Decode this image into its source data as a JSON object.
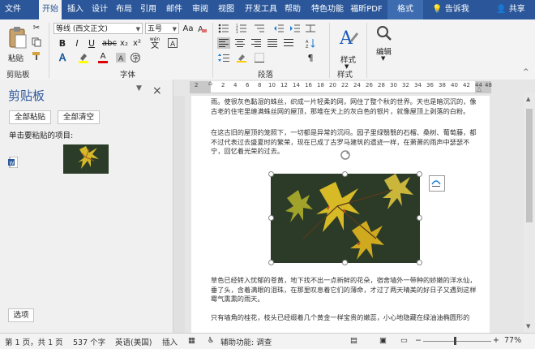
{
  "tabs": [
    "文件",
    "开始",
    "插入",
    "设计",
    "布局",
    "引用",
    "邮件",
    "审阅",
    "视图",
    "开发工具",
    "帮助",
    "特色功能",
    "福昕PDF",
    "格式"
  ],
  "tell_me": "告诉我",
  "share": "共享",
  "ribbon": {
    "paste_label": "粘贴",
    "clipboard_group": "剪贴板",
    "font_name": "等线 (西文正文)",
    "font_size": "五号",
    "font_group": "字体",
    "paragraph_group": "段落",
    "styles_group": "样式",
    "styles_label": "样式",
    "editing_label": "编辑",
    "bold": "B",
    "italic": "I",
    "underline": "U",
    "wen": "wén",
    "font_a": "A",
    "aa": "Aa",
    "highlight_color": "#ffff00",
    "font_color": "#e00000"
  },
  "clipboard_pane": {
    "title": "剪贴板",
    "paste_all": "全部粘贴",
    "clear_all": "全部清空",
    "hint": "单击要粘贴的项目:",
    "options": "选项"
  },
  "ruler_ticks": [
    "2",
    "2",
    "4",
    "6",
    "8",
    "10",
    "12",
    "14",
    "16",
    "18",
    "20",
    "22",
    "24",
    "26",
    "28",
    "30",
    "32",
    "34",
    "36",
    "38",
    "40",
    "42",
    "44",
    "48"
  ],
  "document": {
    "p1": "雨。使很灰色黏湿的蛛丝，织成一片轻柔的网，网住了整个秋的世界。天也是暗沉沉的，像古老的住宅里缠满蛛丝网的屋顶，那堆在天上的灰白色的银片，就像屋顶上剥落的白粉。",
    "p2": "在这古旧的屋顶的笼照下，一切都是异常的沉闷。园子里绿翳翳的石榴、桑树、葡萄藤，都不过代表过去盛夏时的繁荣，现在已成了古罗马建筑的遗迹一样，在萧萧的雨声中瑟瑟不宁，回忆着光荣的过去。",
    "p3": "草色已经转入忧郁的苍黄，地下找不出一点新鲜的花朵，宿舍墙外一带种的娇嫩的洋水仙，垂了头，含着满眼的泪珠，在那里叹息着它们的薄命，才过了两天晴美的好日子又遇到这样霉气熏熏的雨天。",
    "p4": "只有墙角的桂花，枝头已经缀着几个黄金一样宝贵的嫩蕊，小心地隐藏在绿油油椭圆形的"
  },
  "status": {
    "page": "第 1 页，共 1 页",
    "words": "537 个字",
    "language": "英语(美国)",
    "mode": "插入",
    "accessibility": "辅助功能: 调查",
    "zoom": "77%"
  },
  "colors": {
    "brand": "#2b579a"
  }
}
